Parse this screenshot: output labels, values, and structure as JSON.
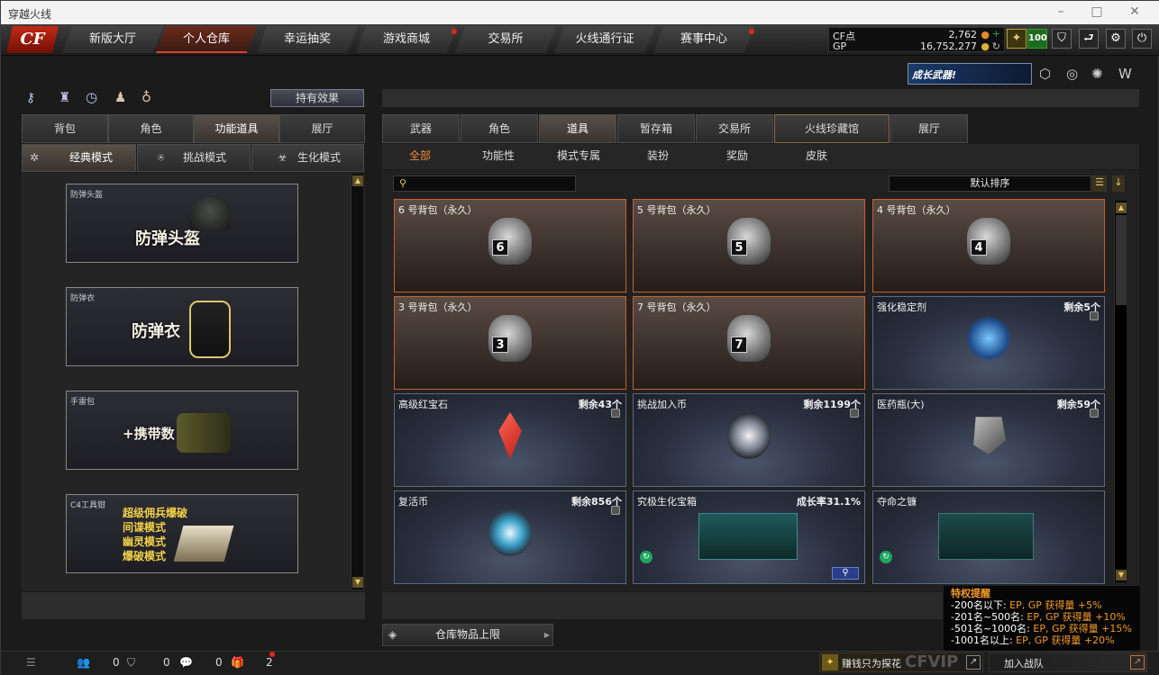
{
  "window": {
    "title": "穿越火线"
  },
  "logo": "CF",
  "nav": {
    "items": [
      "新版大厅",
      "个人仓库",
      "幸运抽奖",
      "游戏商城",
      "交易所",
      "火线通行证",
      "赛事中心"
    ]
  },
  "currency": {
    "cf_label": "CF点",
    "cf_value": "2,762",
    "gp_label": "GP",
    "gp_value": "16,752,277"
  },
  "level_badge": "100",
  "banner": "成长武器!",
  "left": {
    "effects_button": "持有效果",
    "tabs": [
      "背包",
      "角色",
      "功能道具",
      "展厅"
    ],
    "active_tab": 2,
    "modes": [
      "经典模式",
      "挑战模式",
      "生化模式"
    ],
    "cards": [
      {
        "label": "防弹头盔",
        "title": "防弹头盔"
      },
      {
        "label": "防弹衣",
        "title": "防弹衣"
      },
      {
        "label": "手雷包",
        "title": "+携带数"
      },
      {
        "label": "C4工具钳",
        "lines": [
          "超级佣兵爆破",
          "间谍模式",
          "幽灵模式",
          "爆破模式"
        ]
      }
    ]
  },
  "right": {
    "tabs": [
      "武器",
      "角色",
      "道具",
      "暂存箱",
      "交易所",
      "火线珍藏馆",
      "展厅"
    ],
    "active_tab": 2,
    "subtabs": [
      "全部",
      "功能性",
      "模式专属",
      "装扮",
      "奖励",
      "皮肤"
    ],
    "active_subtab": 0,
    "sort": "默认排序",
    "items": [
      {
        "name": "6 号背包（永久）",
        "bag": "6",
        "style": "bag"
      },
      {
        "name": "5 号背包（永久）",
        "bag": "5",
        "style": "bag"
      },
      {
        "name": "4 号背包（永久）",
        "bag": "4",
        "style": "bag"
      },
      {
        "name": "3 号背包（永久）",
        "bag": "3",
        "style": "bag"
      },
      {
        "name": "7 号背包（永久）",
        "bag": "7",
        "style": "bag"
      },
      {
        "name": "强化稳定剂",
        "right": "剩余5个",
        "style": "blue",
        "lock": true
      },
      {
        "name": "高级红宝石",
        "right": "剩余43个",
        "style": "blue",
        "lock": true
      },
      {
        "name": "挑战加入币",
        "right": "剩余1199个",
        "style": "blue",
        "lock": true
      },
      {
        "name": "医药瓶(大)",
        "right": "剩余59个",
        "style": "blue",
        "lock": true
      },
      {
        "name": "复活币",
        "right": "剩余856个",
        "style": "blue",
        "lock": true
      },
      {
        "name": "究极生化宝箱",
        "right": "成长率31.1%",
        "style": "blue",
        "green": true
      },
      {
        "name": "夺命之镰",
        "right": "",
        "style": "blue",
        "green": true
      }
    ],
    "capacity": "仓库物品上限"
  },
  "tip": {
    "title": "特权提醒",
    "rows": [
      {
        "a": "-200名以下: ",
        "b": "EP, GP 获得量 +5%"
      },
      {
        "a": "-201名~500名: ",
        "b": "EP, GP 获得量 +10%"
      },
      {
        "a": "-501名~1000名: ",
        "b": "EP, GP 获得量 +15%"
      },
      {
        "a": "-1001名以上: ",
        "b": "EP, GP 获得量 +20%"
      }
    ]
  },
  "bottom": {
    "counts": [
      "0",
      "0",
      "0",
      "2"
    ],
    "promo": "赚钱只为探花",
    "join": "加入战队",
    "watermark": "CFVIP"
  },
  "colors": {
    "accent": "#d9442a",
    "item_border": "#c8602c",
    "gold": "#e3c76a"
  }
}
